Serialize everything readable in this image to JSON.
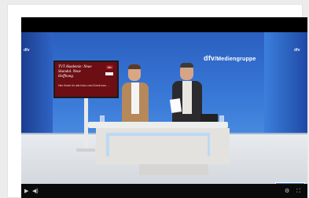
{
  "studio": {
    "logo_prefix": "dfv",
    "logo_suffix": "/Mediengruppe",
    "corner_logo_left": "dfv",
    "corner_logo_right": "dfv",
    "screen": {
      "headline": "TVT Akademie: Neue Skandal. Neue Hoffnung.",
      "badge": "dfv",
      "body": "Hier findet Ihr alle Infos zum Event bzw. ..."
    }
  },
  "player": {
    "play_icon": "play-icon",
    "volume_icon": "volume-icon",
    "settings_icon": "gear-icon",
    "fullscreen_icon": "fullscreen-icon"
  }
}
